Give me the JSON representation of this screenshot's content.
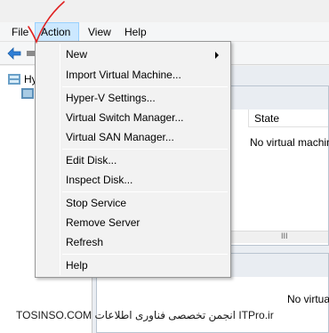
{
  "menubar": {
    "file": "File",
    "action": "Action",
    "view": "View",
    "help": "Help"
  },
  "tree": {
    "root_label": "Hy"
  },
  "content": {
    "state_header": "State",
    "no_vms": "No virtual machines",
    "no_virtual": "No virtual",
    "scroll_marker": "III"
  },
  "action_menu": {
    "items": [
      {
        "label": "New",
        "has_submenu": true
      },
      {
        "label": "Import Virtual Machine..."
      },
      {
        "label": "Hyper-V Settings..."
      },
      {
        "label": "Virtual Switch Manager..."
      },
      {
        "label": "Virtual SAN Manager..."
      },
      {
        "label": "Edit Disk..."
      },
      {
        "label": "Inspect Disk..."
      },
      {
        "label": "Stop Service"
      },
      {
        "label": "Remove Server"
      },
      {
        "label": "Refresh"
      },
      {
        "label": "Help"
      }
    ]
  },
  "watermark": "TOSINSO.COM انجمن تخصصی فناوری اطلاعات ITPro.ir",
  "colors": {
    "menu_highlight": "#cce8ff",
    "annotation_red": "#e02020",
    "back_arrow_blue": "#2f7fd6"
  }
}
